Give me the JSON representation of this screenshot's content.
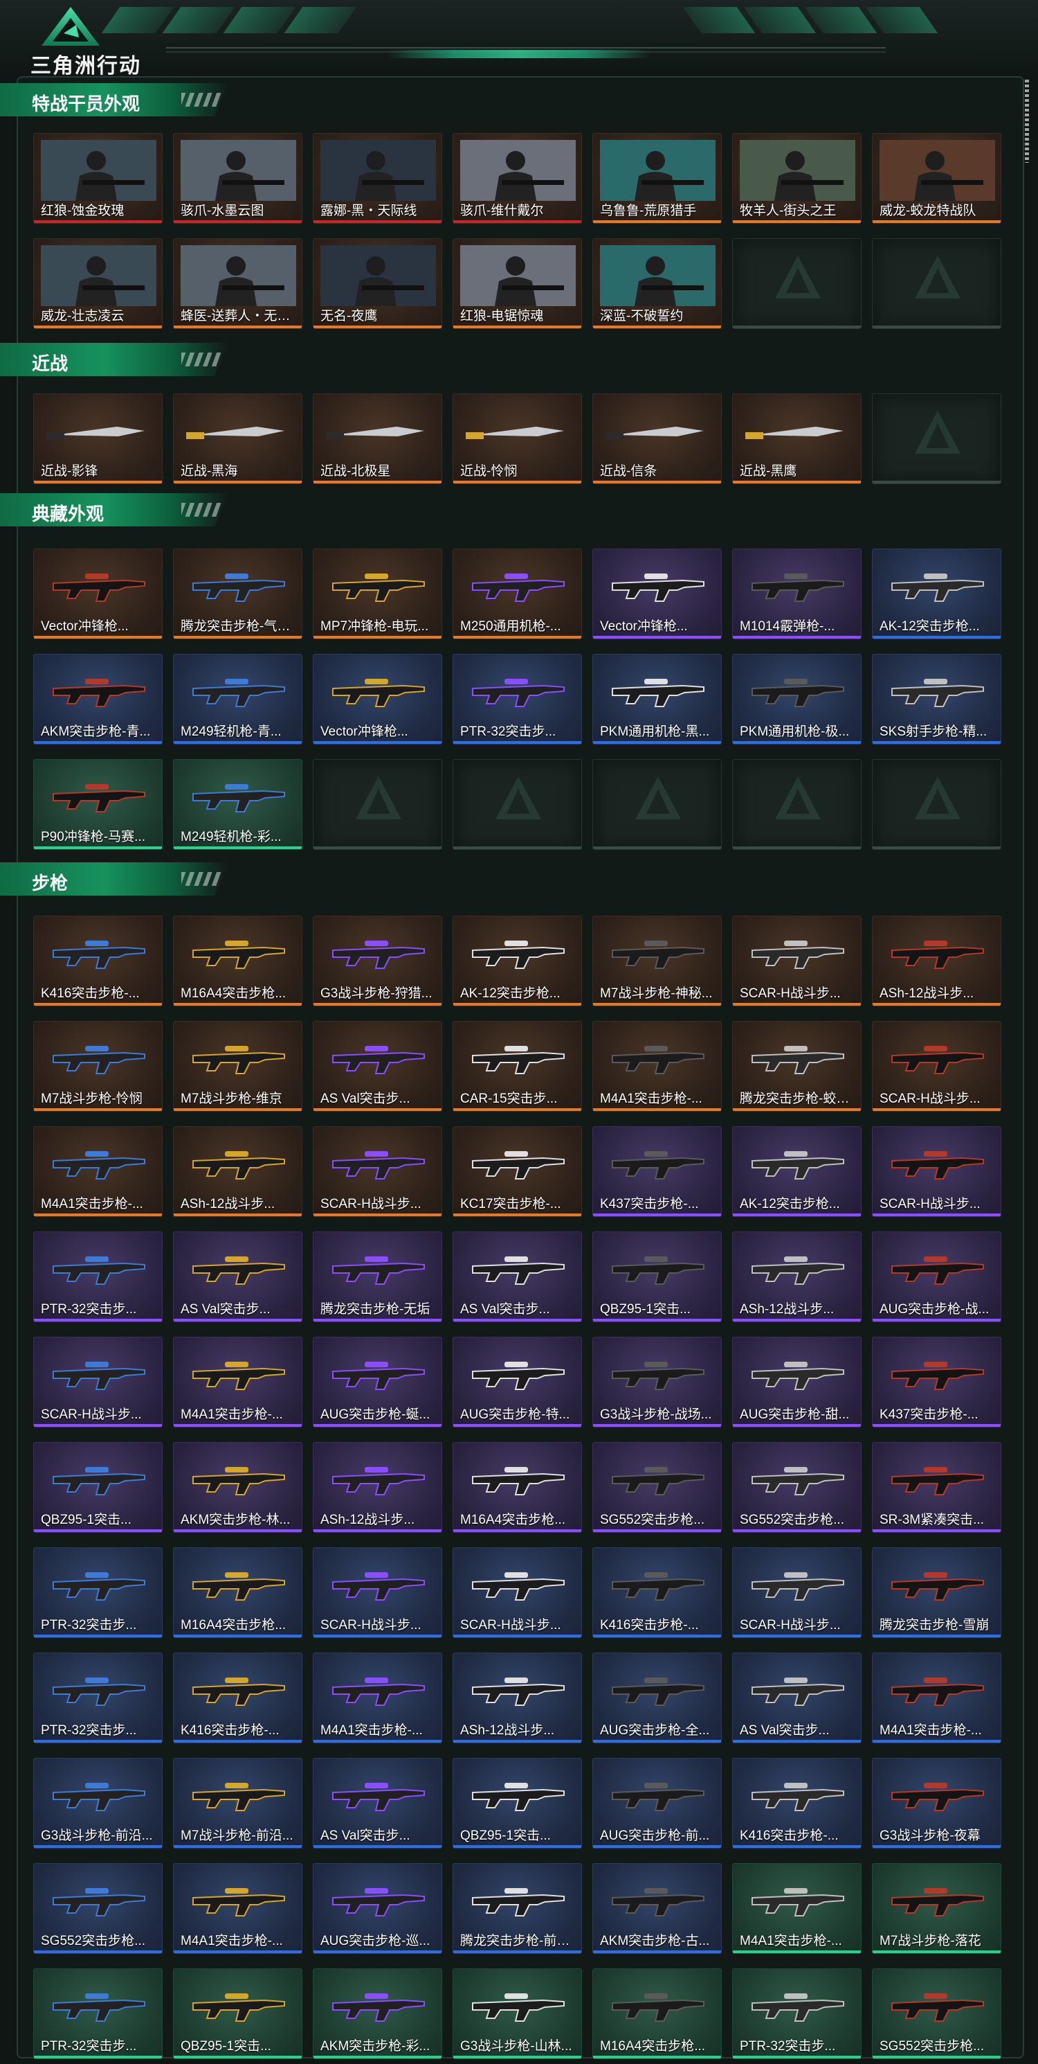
{
  "app": {
    "brand": "三角洲行动"
  },
  "colors": {
    "accent": "#1fa37a",
    "orange": "#e37a2b",
    "purple": "#8a4dff",
    "blue": "#2f6ee0",
    "green": "#2bd18a",
    "red": "#c8262a"
  },
  "sections": [
    {
      "title": "特战干员外观",
      "items": [
        {
          "name": "红狼-蚀金玫瑰",
          "rarity": "red"
        },
        {
          "name": "骇爪-水墨云图",
          "rarity": "red"
        },
        {
          "name": "露娜-黑・天际线",
          "rarity": "red"
        },
        {
          "name": "骇爪-维什戴尔",
          "rarity": "red"
        },
        {
          "name": "乌鲁鲁-荒原猎手",
          "rarity": "orange"
        },
        {
          "name": "牧羊人-街头之王",
          "rarity": "orange"
        },
        {
          "name": "威龙-蛟龙特战队",
          "rarity": "orange"
        },
        {
          "name": "威龙-壮志凌云",
          "rarity": "orange"
        },
        {
          "name": "蜂医-送葬人・无题...",
          "rarity": "orange"
        },
        {
          "name": "无名-夜鹰",
          "rarity": "orange"
        },
        {
          "name": "红狼-电锯惊魂",
          "rarity": "orange"
        },
        {
          "name": "深蓝-不破誓约",
          "rarity": "orange"
        },
        {
          "name": "",
          "rarity": "empty"
        },
        {
          "name": "",
          "rarity": "empty"
        }
      ]
    },
    {
      "title": "近战",
      "items": [
        {
          "name": "近战-影锋",
          "rarity": "orange"
        },
        {
          "name": "近战-黑海",
          "rarity": "orange"
        },
        {
          "name": "近战-北极星",
          "rarity": "orange"
        },
        {
          "name": "近战-怜悯",
          "rarity": "orange"
        },
        {
          "name": "近战-信条",
          "rarity": "orange"
        },
        {
          "name": "近战-黑鹰",
          "rarity": "orange"
        },
        {
          "name": "",
          "rarity": "empty"
        }
      ]
    },
    {
      "title": "典藏外观",
      "items": [
        {
          "name": "Vector冲锋枪...",
          "rarity": "orange"
        },
        {
          "name": "腾龙突击步枪-气象...",
          "rarity": "orange"
        },
        {
          "name": "MP7冲锋枪-电玩...",
          "rarity": "orange"
        },
        {
          "name": "M250通用机枪-...",
          "rarity": "orange"
        },
        {
          "name": "Vector冲锋枪...",
          "rarity": "purple"
        },
        {
          "name": "M1014霰弹枪-...",
          "rarity": "purple"
        },
        {
          "name": "AK-12突击步枪...",
          "rarity": "blue"
        },
        {
          "name": "AKM突击步枪-青...",
          "rarity": "blue"
        },
        {
          "name": "M249轻机枪-青...",
          "rarity": "blue"
        },
        {
          "name": "Vector冲锋枪...",
          "rarity": "blue"
        },
        {
          "name": "PTR-32突击步...",
          "rarity": "blue"
        },
        {
          "name": "PKM通用机枪-黑...",
          "rarity": "blue"
        },
        {
          "name": "PKM通用机枪-极...",
          "rarity": "blue"
        },
        {
          "name": "SKS射手步枪-精...",
          "rarity": "blue"
        },
        {
          "name": "P90冲锋枪-马赛...",
          "rarity": "green"
        },
        {
          "name": "M249轻机枪-彩...",
          "rarity": "green"
        },
        {
          "name": "",
          "rarity": "empty"
        },
        {
          "name": "",
          "rarity": "empty"
        },
        {
          "name": "",
          "rarity": "empty"
        },
        {
          "name": "",
          "rarity": "empty"
        },
        {
          "name": "",
          "rarity": "empty"
        }
      ]
    },
    {
      "title": "步枪",
      "items": [
        {
          "name": "K416突击步枪-...",
          "rarity": "orange"
        },
        {
          "name": "M16A4突击步枪...",
          "rarity": "orange"
        },
        {
          "name": "G3战斗步枪-狩猎...",
          "rarity": "orange"
        },
        {
          "name": "AK-12突击步枪...",
          "rarity": "orange"
        },
        {
          "name": "M7战斗步枪-神秘...",
          "rarity": "orange"
        },
        {
          "name": "SCAR-H战斗步...",
          "rarity": "orange"
        },
        {
          "name": "ASh-12战斗步...",
          "rarity": "orange"
        },
        {
          "name": "M7战斗步枪-怜悯",
          "rarity": "orange"
        },
        {
          "name": "M7战斗步枪-维京",
          "rarity": "orange"
        },
        {
          "name": "AS Val突击步...",
          "rarity": "orange"
        },
        {
          "name": "CAR-15突击步...",
          "rarity": "orange"
        },
        {
          "name": "M4A1突击步枪-...",
          "rarity": "orange"
        },
        {
          "name": "腾龙突击步枪-蛟龙...",
          "rarity": "orange"
        },
        {
          "name": "SCAR-H战斗步...",
          "rarity": "orange"
        },
        {
          "name": "M4A1突击步枪-...",
          "rarity": "orange"
        },
        {
          "name": "ASh-12战斗步...",
          "rarity": "orange"
        },
        {
          "name": "SCAR-H战斗步...",
          "rarity": "orange"
        },
        {
          "name": "KC17突击步枪-...",
          "rarity": "orange"
        },
        {
          "name": "K437突击步枪-...",
          "rarity": "purple"
        },
        {
          "name": "AK-12突击步枪...",
          "rarity": "purple"
        },
        {
          "name": "SCAR-H战斗步...",
          "rarity": "purple"
        },
        {
          "name": "PTR-32突击步...",
          "rarity": "purple"
        },
        {
          "name": "AS Val突击步...",
          "rarity": "purple"
        },
        {
          "name": "腾龙突击步枪-无垢",
          "rarity": "purple"
        },
        {
          "name": "AS Val突击步...",
          "rarity": "purple"
        },
        {
          "name": "QBZ95-1突击...",
          "rarity": "purple"
        },
        {
          "name": "ASh-12战斗步...",
          "rarity": "purple"
        },
        {
          "name": "AUG突击步枪-战...",
          "rarity": "purple"
        },
        {
          "name": "SCAR-H战斗步...",
          "rarity": "purple"
        },
        {
          "name": "M4A1突击步枪-...",
          "rarity": "purple"
        },
        {
          "name": "AUG突击步枪-蜒...",
          "rarity": "purple"
        },
        {
          "name": "AUG突击步枪-特...",
          "rarity": "purple"
        },
        {
          "name": "G3战斗步枪-战场...",
          "rarity": "purple"
        },
        {
          "name": "AUG突击步枪-甜...",
          "rarity": "purple"
        },
        {
          "name": "K437突击步枪-...",
          "rarity": "purple"
        },
        {
          "name": "QBZ95-1突击...",
          "rarity": "purple"
        },
        {
          "name": "AKM突击步枪-林...",
          "rarity": "purple"
        },
        {
          "name": "ASh-12战斗步...",
          "rarity": "purple"
        },
        {
          "name": "M16A4突击步枪...",
          "rarity": "purple"
        },
        {
          "name": "SG552突击步枪...",
          "rarity": "purple"
        },
        {
          "name": "SG552突击步枪...",
          "rarity": "purple"
        },
        {
          "name": "SR-3M紧凑突击...",
          "rarity": "purple"
        },
        {
          "name": "PTR-32突击步...",
          "rarity": "blue"
        },
        {
          "name": "M16A4突击步枪...",
          "rarity": "blue"
        },
        {
          "name": "SCAR-H战斗步...",
          "rarity": "blue"
        },
        {
          "name": "SCAR-H战斗步...",
          "rarity": "blue"
        },
        {
          "name": "K416突击步枪-...",
          "rarity": "blue"
        },
        {
          "name": "SCAR-H战斗步...",
          "rarity": "blue"
        },
        {
          "name": "腾龙突击步枪-雪崩",
          "rarity": "blue"
        },
        {
          "name": "PTR-32突击步...",
          "rarity": "blue"
        },
        {
          "name": "K416突击步枪-...",
          "rarity": "blue"
        },
        {
          "name": "M4A1突击步枪-...",
          "rarity": "blue"
        },
        {
          "name": "ASh-12战斗步...",
          "rarity": "blue"
        },
        {
          "name": "AUG突击步枪-全...",
          "rarity": "blue"
        },
        {
          "name": "AS Val突击步...",
          "rarity": "blue"
        },
        {
          "name": "M4A1突击步枪-...",
          "rarity": "blue"
        },
        {
          "name": "G3战斗步枪-前沿...",
          "rarity": "blue"
        },
        {
          "name": "M7战斗步枪-前沿...",
          "rarity": "blue"
        },
        {
          "name": "AS Val突击步...",
          "rarity": "blue"
        },
        {
          "name": "QBZ95-1突击...",
          "rarity": "blue"
        },
        {
          "name": "AUG突击步枪-前...",
          "rarity": "blue"
        },
        {
          "name": "K416突击步枪-...",
          "rarity": "blue"
        },
        {
          "name": "G3战斗步枪-夜幕",
          "rarity": "blue"
        },
        {
          "name": "SG552突击步枪...",
          "rarity": "blue"
        },
        {
          "name": "M4A1突击步枪-...",
          "rarity": "blue"
        },
        {
          "name": "AUG突击步枪-巡...",
          "rarity": "blue"
        },
        {
          "name": "腾龙突击步枪-前沿...",
          "rarity": "blue"
        },
        {
          "name": "AKM突击步枪-古...",
          "rarity": "blue"
        },
        {
          "name": "M4A1突击步枪-...",
          "rarity": "green"
        },
        {
          "name": "M7战斗步枪-落花",
          "rarity": "green"
        },
        {
          "name": "PTR-32突击步...",
          "rarity": "green"
        },
        {
          "name": "QBZ95-1突击...",
          "rarity": "green"
        },
        {
          "name": "AKM突击步枪-彩...",
          "rarity": "green"
        },
        {
          "name": "G3战斗步枪-山林...",
          "rarity": "green"
        },
        {
          "name": "M16A4突击步枪...",
          "rarity": "green"
        },
        {
          "name": "PTR-32突击步...",
          "rarity": "green"
        },
        {
          "name": "SG552突击步枪...",
          "rarity": "green"
        }
      ]
    }
  ]
}
